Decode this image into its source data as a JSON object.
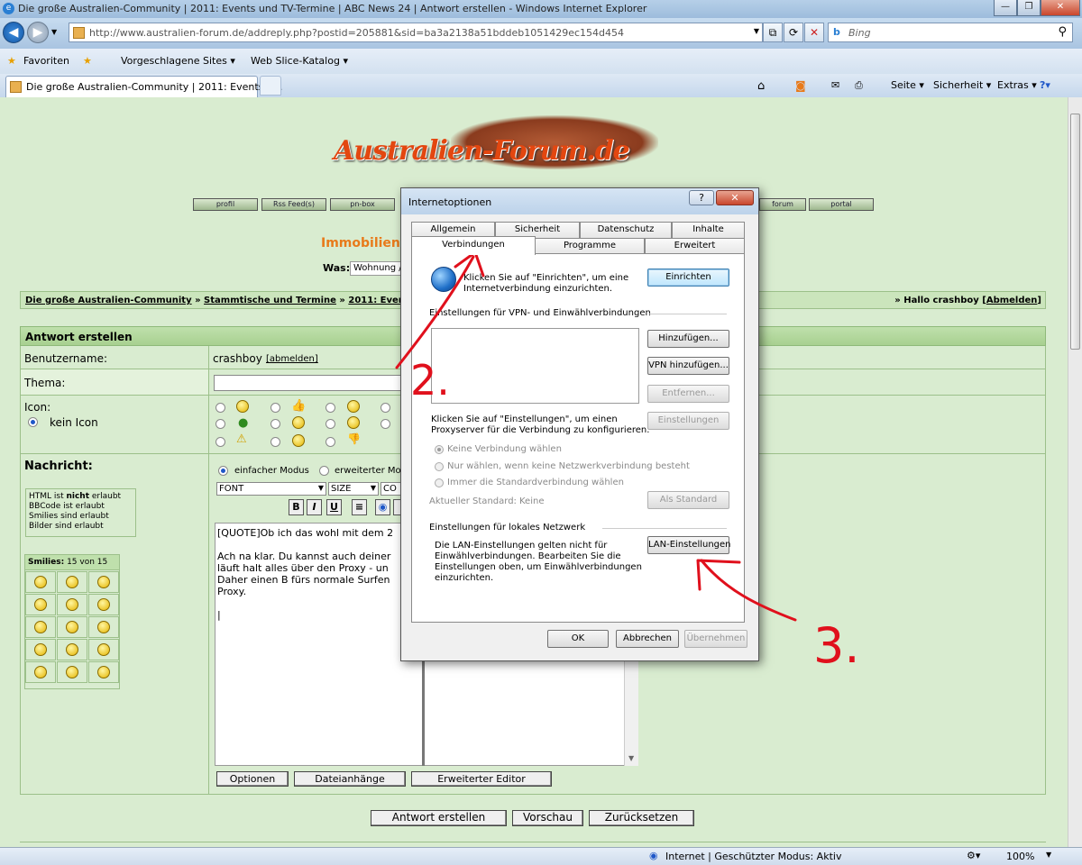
{
  "window": {
    "title": "Die große Australien-Community | 2011: Events und TV-Termine | ABC News 24 | Antwort erstellen - Windows Internet Explorer",
    "url": "http://www.australien-forum.de/addreply.php?postid=205881&sid=ba3a2138a51bddeb1051429ec154d454",
    "search_placeholder": "Bing",
    "fav_label": "Favoriten",
    "fav_items": [
      "Vorgeschlagene Sites ▾",
      "Web Slice-Katalog ▾"
    ],
    "tab_label": "Die große Australien-Community | 2011: Events u...",
    "commands": [
      "Seite ▾",
      "Sicherheit ▾",
      "Extras ▾"
    ],
    "status_text": "Internet | Geschützter Modus: Aktiv",
    "zoom": "100%"
  },
  "site": {
    "logo": "Australien-Forum.de",
    "nav_buttons": [
      "profil",
      "Rss Feed(s)",
      "pn-box",
      "forum",
      "portal"
    ],
    "immo_title": "Immobilien s",
    "was_label": "Was:",
    "was_value": "Wohnung /",
    "breadcrumb": [
      "Die große Australien-Community",
      "Stammtische und Termine",
      "2011: Events u"
    ],
    "breadcrumb_sep": "»",
    "user_greeting": "» Hallo crashboy [",
    "logout": "Abmelden",
    "greeting_close": "]"
  },
  "form": {
    "heading": "Antwort erstellen",
    "username_label": "Benutzername:",
    "username_value": "crashboy",
    "abmelden": "[abmelden]",
    "thema_label": "Thema:",
    "icon_label": "Icon:",
    "no_icon": "kein Icon",
    "message_label": "Nachricht:",
    "mode_simple": "einfacher Modus",
    "mode_extended": "erweiterter Mo",
    "font_select": "FONT",
    "size_select": "SIZE",
    "color_select": "CO",
    "fmt": [
      "B",
      "I",
      "U",
      "≡"
    ],
    "perm_html_a": "HTML ist ",
    "perm_html_b": "nicht",
    "perm_html_c": " erlaubt",
    "perm_bbcode": "BBCode ist erlaubt",
    "perm_smilies": "Smilies sind erlaubt",
    "perm_images": "Bilder sind erlaubt",
    "smilies_head": "Smilies:",
    "smilies_count": "15 von 15",
    "text": "[QUOTE]Ob ich das wohl mit dem 2\n\nAch na klar. Du kannst auch deiner\nläuft halt alles über den Proxy - un\nDaher einen B fürs normale Surfen\nProxy.\n\n|",
    "btn_options": "Optionen",
    "btn_attach": "Dateianhänge",
    "btn_editor": "Erweiterter Editor",
    "btn_submit": "Antwort erstellen",
    "btn_preview": "Vorschau",
    "btn_reset": "Zurücksetzen"
  },
  "dialog": {
    "title": "Internetoptionen",
    "help": "?",
    "close": "✕",
    "tabs_back": [
      "Allgemein",
      "Sicherheit",
      "Datenschutz",
      "Inhalte"
    ],
    "tabs_front": [
      "Verbindungen",
      "Programme",
      "Erweitert"
    ],
    "setup_text1": "Klicken Sie auf \"Einrichten\", um eine",
    "setup_text2": "Internetverbindung einzurichten.",
    "btn_setup": "Einrichten",
    "vpn_label": "Einstellungen für VPN- und Einwählverbindungen",
    "btn_add": "Hinzufügen...",
    "btn_add_vpn": "VPN hinzufügen...",
    "btn_remove": "Entfernen...",
    "proxy_text1": "Klicken Sie auf \"Einstellungen\", um einen",
    "proxy_text2": "Proxyserver für die Verbindung zu konfigurieren.",
    "btn_settings": "Einstellungen",
    "radio1": "Keine Verbindung wählen",
    "radio2": "Nur wählen, wenn keine Netzwerkverbindung besteht",
    "radio3": "Immer die Standardverbindung wählen",
    "current_default_label": "Aktueller Standard:",
    "current_default_value": "Keine",
    "btn_default": "Als Standard",
    "lan_label": "Einstellungen für lokales Netzwerk",
    "lan_text1": "Die LAN-Einstellungen gelten nicht für",
    "lan_text2": "Einwählverbindungen. Bearbeiten Sie die",
    "lan_text3": "Einstellungen oben, um Einwählverbindungen",
    "lan_text4": "einzurichten.",
    "btn_lan": "LAN-Einstellungen",
    "btn_ok": "OK",
    "btn_cancel": "Abbrechen",
    "btn_apply": "Übernehmen"
  },
  "annotations": {
    "step2": "2.",
    "step3": "3.",
    "color": "#e0101c"
  }
}
